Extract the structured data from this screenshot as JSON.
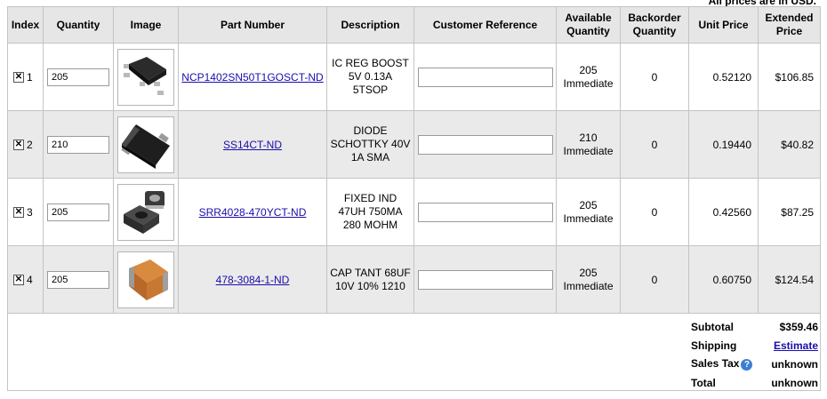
{
  "note": "All prices are in USD.",
  "headers": {
    "index": "Index",
    "quantity": "Quantity",
    "image": "Image",
    "part_number": "Part Number",
    "description": "Description",
    "customer_reference": "Customer Reference",
    "available_quantity_1": "Available",
    "available_quantity_2": "Quantity",
    "backorder_quantity_1": "Backorder",
    "backorder_quantity_2": "Quantity",
    "unit_price": "Unit Price",
    "extended_price_1": "Extended",
    "extended_price_2": "Price"
  },
  "items": [
    {
      "index": "1",
      "checked_glyph": "✕",
      "quantity": "205",
      "image_icon": "sot23-5-ic-image",
      "part_number": "NCP1402SN50T1GOSCT-ND",
      "description": [
        "IC REG BOOST",
        "5V 0.13A",
        "5TSOP"
      ],
      "customer_reference": "",
      "available_qty": "205",
      "available_status": "Immediate",
      "backorder": "0",
      "unit_price": "0.52120",
      "extended_price": "$106.85"
    },
    {
      "index": "2",
      "checked_glyph": "✕",
      "quantity": "210",
      "image_icon": "sma-diode-image",
      "part_number": "SS14CT-ND",
      "description": [
        "DIODE",
        "SCHOTTKY 40V",
        "1A SMA"
      ],
      "customer_reference": "",
      "available_qty": "210",
      "available_status": "Immediate",
      "backorder": "0",
      "unit_price": "0.19440",
      "extended_price": "$40.82"
    },
    {
      "index": "3",
      "checked_glyph": "✕",
      "quantity": "205",
      "image_icon": "smd-inductor-image",
      "part_number": "SRR4028-470YCT-ND",
      "description": [
        "FIXED IND",
        "47UH 750MA",
        "280 MOHM"
      ],
      "customer_reference": "",
      "available_qty": "205",
      "available_status": "Immediate",
      "backorder": "0",
      "unit_price": "0.42560",
      "extended_price": "$87.25"
    },
    {
      "index": "4",
      "checked_glyph": "✕",
      "quantity": "205",
      "image_icon": "tantalum-capacitor-image",
      "part_number": "478-3084-1-ND",
      "description": [
        "CAP TANT 68UF",
        "10V 10% 1210"
      ],
      "customer_reference": "",
      "available_qty": "205",
      "available_status": "Immediate",
      "backorder": "0",
      "unit_price": "0.60750",
      "extended_price": "$124.54"
    }
  ],
  "totals": {
    "subtotal_label": "Subtotal",
    "subtotal_value": "$359.46",
    "shipping_label": "Shipping",
    "shipping_value": "Estimate",
    "sales_tax_label": "Sales Tax",
    "sales_tax_help_glyph": "?",
    "sales_tax_value": "unknown",
    "total_label": "Total",
    "total_value": "unknown"
  },
  "colors": {
    "link": "#1a0dab",
    "header_bg": "#e6e6e6",
    "alt_row_bg": "#eaeaea",
    "help_icon": "#3b7fd4"
  }
}
